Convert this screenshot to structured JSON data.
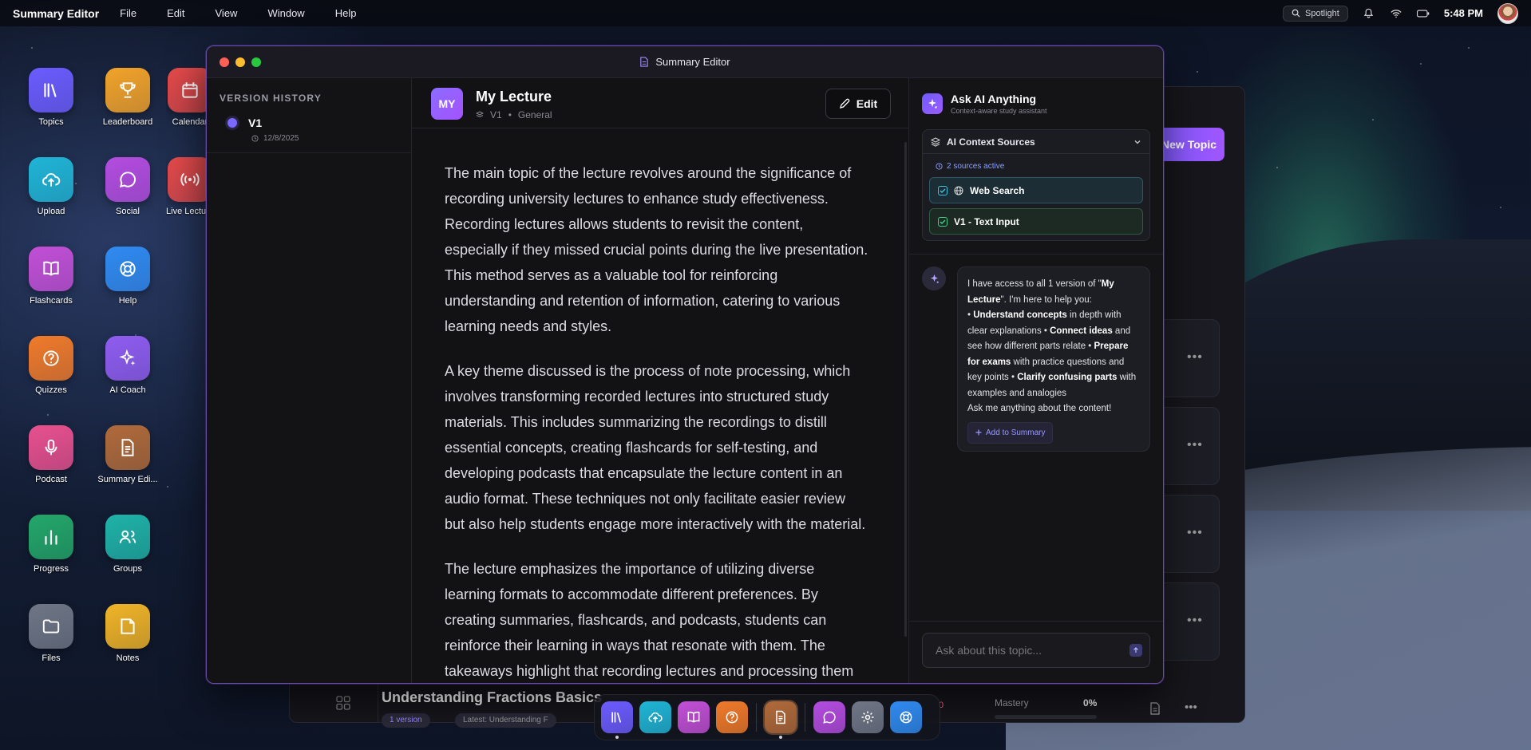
{
  "menubar": {
    "app_name": "Summary Editor",
    "menus": [
      "File",
      "Edit",
      "View",
      "Window",
      "Help"
    ],
    "spotlight": "Spotlight",
    "time": "5:48 PM"
  },
  "desktop_icons": [
    {
      "label": "Topics",
      "icon": "library-icon",
      "color": "#6b5cff"
    },
    {
      "label": "Leaderboard",
      "icon": "trophy-icon",
      "color": "#f2a32a"
    },
    {
      "label": "Calendar",
      "icon": "calendar-icon",
      "color": "#e74a4a"
    },
    {
      "label": "Upload",
      "icon": "cloud-upload-icon",
      "color": "#1fb5d6"
    },
    {
      "label": "Social",
      "icon": "chat-icon",
      "color": "#b44ce0"
    },
    {
      "label": "Live Lecture",
      "icon": "broadcast-icon",
      "color": "#e74a4a"
    },
    {
      "label": "Flashcards",
      "icon": "book-icon",
      "color": "#c24fd6"
    },
    {
      "label": "Help",
      "icon": "lifebuoy-icon",
      "color": "#2f8af0"
    },
    {
      "label": "Quizzes",
      "icon": "question-icon",
      "color": "#f07a2a"
    },
    {
      "label": "AI Coach",
      "icon": "sparkles-icon",
      "color": "#8f5cf0"
    },
    {
      "label": "Podcast",
      "icon": "microphone-icon",
      "color": "#e8508f"
    },
    {
      "label": "Summary Edi...",
      "icon": "document-icon",
      "color": "#b06a3a"
    },
    {
      "label": "Progress",
      "icon": "bar-chart-icon",
      "color": "#23a76a"
    },
    {
      "label": "Groups",
      "icon": "users-icon",
      "color": "#1fb3a8"
    },
    {
      "label": "Files",
      "icon": "folder-icon",
      "color": "#6f7686"
    },
    {
      "label": "Notes",
      "icon": "note-icon",
      "color": "#f0b428"
    }
  ],
  "background_window": {
    "new_topic": "New Topic",
    "topic_title": "Understanding Fractions Basics",
    "chip_version": "1 version",
    "chip_latest": "Latest: Understanding F",
    "count": "0",
    "mastery_label": "Mastery",
    "mastery_value": "0%",
    "mastery_fraction": 0
  },
  "window": {
    "title": "Summary Editor"
  },
  "sidebar": {
    "heading": "VERSION HISTORY",
    "versions": [
      {
        "label": "V1",
        "date": "12/8/2025"
      }
    ]
  },
  "document": {
    "avatar": "MY",
    "title": "My Lecture",
    "version": "V1",
    "category": "General",
    "edit_label": "Edit",
    "paragraphs": [
      "The main topic of the lecture revolves around the significance of recording university lectures to enhance study effectiveness. Recording lectures allows students to revisit the content, especially if they missed crucial points during the live presentation. This method serves as a valuable tool for reinforcing understanding and retention of information, catering to various learning needs and styles.",
      "A key theme discussed is the process of note processing, which involves transforming recorded lectures into structured study materials. This includes summarizing the recordings to distill essential concepts, creating flashcards for self-testing, and developing podcasts that encapsulate the lecture content in an audio format. These techniques not only facilitate easier review but also help students engage more interactively with the material.",
      "The lecture emphasizes the importance of utilizing diverse learning formats to accommodate different preferences. By creating summaries, flashcards, and podcasts, students can reinforce their learning in ways that resonate with them. The takeaways highlight that recording lectures and processing them into various study aids"
    ]
  },
  "ai_panel": {
    "title": "Ask AI Anything",
    "subtitle": "Context-aware study assistant",
    "context_title": "AI Context Sources",
    "sources_active": "2 sources active",
    "sources": [
      "Web Search",
      "V1 - Text Input"
    ],
    "message": {
      "intro_pre": "I have access to all 1 version of \"",
      "intro_bold": "My Lecture",
      "intro_post": "\". I'm here to help you:",
      "b1": "Understand concepts",
      "t1": " in depth with clear explanations • ",
      "b2": "Connect ideas",
      "t2": " and see how different parts relate • ",
      "b3": "Prepare for exams",
      "t3": " with practice questions and key points • ",
      "b4": "Clarify confusing parts",
      "t4": " with examples and analogies",
      "closing": "Ask me anything about the content!",
      "add_button": "Add to Summary"
    },
    "input_placeholder": "Ask about this topic..."
  },
  "dock": [
    {
      "icon": "library-icon",
      "color": "#6b5cff"
    },
    {
      "icon": "cloud-upload-icon",
      "color": "#1fb5d6"
    },
    {
      "icon": "book-icon",
      "color": "#c24fd6"
    },
    {
      "icon": "question-icon",
      "color": "#f07a2a"
    },
    {
      "icon": "document-icon",
      "color": "#b06a3a"
    },
    {
      "icon": "chat-icon",
      "color": "#b44ce0"
    },
    {
      "icon": "gear-icon",
      "color": "#6f7686"
    },
    {
      "icon": "lifebuoy-icon",
      "color": "#2f8af0"
    }
  ]
}
